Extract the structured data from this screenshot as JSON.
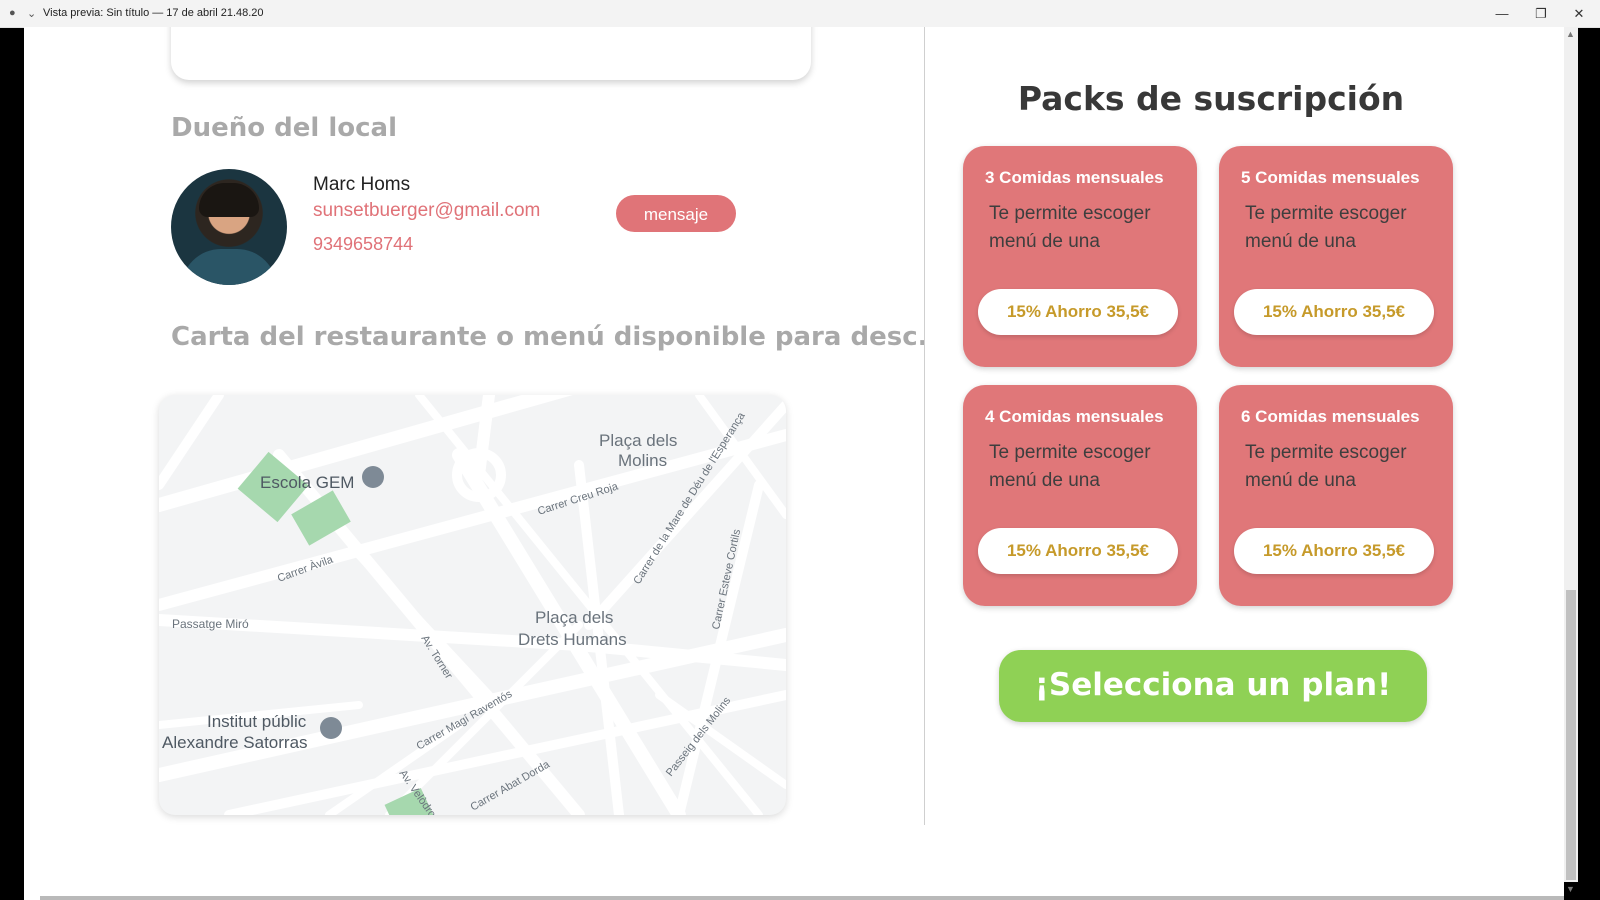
{
  "window": {
    "title": "Vista previa: Sin título — 17 de abril 21.48.20",
    "record_icon": "●",
    "chevron_icon": "⌄",
    "minimize_icon": "—",
    "restore_icon": "❐",
    "close_icon": "✕"
  },
  "owner": {
    "heading": "Dueño del local",
    "name": "Marc Homs",
    "email": "sunsetbuerger@gmail.com",
    "phone": "9349658744",
    "message_button": "mensaje"
  },
  "menu": {
    "heading": "Carta del restaurante o menú disponible para desc."
  },
  "map": {
    "labels": {
      "plaza_molins": "Plaça dels Molins",
      "escola": "Escola GEM",
      "creu_roja": "Carrer Creu Roja",
      "avila": "Carrer Àvila",
      "mare_deu": "Carrer de la Mare de Déu de l'Esperança",
      "esteve": "Carrer Esteve Cortils",
      "miro": "Passatge Miró",
      "drets_1": "Plaça dels",
      "drets_2": "Drets Humans",
      "torner": "Av. Torner",
      "institut_1": "Institut públic",
      "institut_2": "Alexandre Satorras",
      "magi": "Carrer Magí Raventós",
      "molins": "Passeig dels Molins",
      "abat": "Carrer Abat Dorda",
      "velodrom": "Av. Velòdrom"
    }
  },
  "packs": {
    "title": "Packs de suscripción",
    "items": [
      {
        "title": "3 Comidas mensuales",
        "description": "Te permite escoger menú de una",
        "price": "15% Ahorro 35,5€"
      },
      {
        "title": "5 Comidas mensuales",
        "description": "Te permite escoger menú de una",
        "price": "15% Ahorro 35,5€"
      },
      {
        "title": "4 Comidas mensuales",
        "description": "Te permite escoger menú de una",
        "price": "15% Ahorro 35,5€"
      },
      {
        "title": "6 Comidas mensuales",
        "description": "Te permite escoger menú de una",
        "price": "15% Ahorro 35,5€"
      }
    ],
    "cta": "¡Selecciona un plan!"
  },
  "colors": {
    "pack_bg": "#e07779",
    "accent_pink": "#e07278",
    "price_gold": "#c69a2a",
    "cta_green": "#8fd155"
  }
}
